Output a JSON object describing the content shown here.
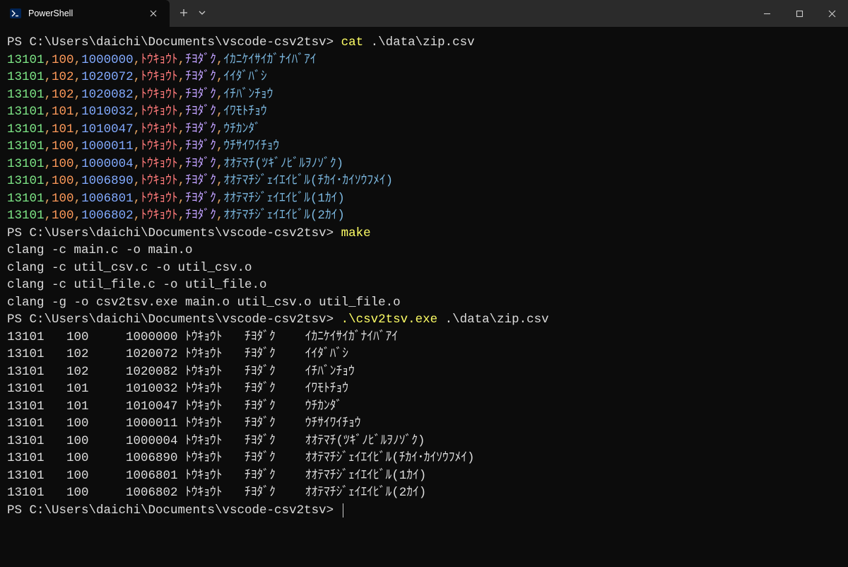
{
  "window": {
    "tab_title": "PowerShell"
  },
  "prompt": "PS C:\\Users\\daichi\\Documents\\vscode-csv2tsv>",
  "commands": {
    "cat": "cat",
    "cat_arg": ".\\data\\zip.csv",
    "make": "make",
    "run": ".\\csv2tsv.exe",
    "run_arg": ".\\data\\zip.csv"
  },
  "csv_rows": [
    {
      "a": "13101",
      "b": "100",
      "c": "1000000",
      "d": "ﾄｳｷｮｳﾄ",
      "e": "ﾁﾖﾀﾞｸ",
      "f": "ｲｶﾆｹｲｻｲｶﾞﾅｲﾊﾞｱｲ"
    },
    {
      "a": "13101",
      "b": "102",
      "c": "1020072",
      "d": "ﾄｳｷｮｳﾄ",
      "e": "ﾁﾖﾀﾞｸ",
      "f": "ｲｲﾀﾞﾊﾞｼ"
    },
    {
      "a": "13101",
      "b": "102",
      "c": "1020082",
      "d": "ﾄｳｷｮｳﾄ",
      "e": "ﾁﾖﾀﾞｸ",
      "f": "ｲﾁﾊﾞﾝﾁｮｳ"
    },
    {
      "a": "13101",
      "b": "101",
      "c": "1010032",
      "d": "ﾄｳｷｮｳﾄ",
      "e": "ﾁﾖﾀﾞｸ",
      "f": "ｲﾜﾓﾄﾁｮｳ"
    },
    {
      "a": "13101",
      "b": "101",
      "c": "1010047",
      "d": "ﾄｳｷｮｳﾄ",
      "e": "ﾁﾖﾀﾞｸ",
      "f": "ｳﾁｶﾝﾀﾞ"
    },
    {
      "a": "13101",
      "b": "100",
      "c": "1000011",
      "d": "ﾄｳｷｮｳﾄ",
      "e": "ﾁﾖﾀﾞｸ",
      "f": "ｳﾁｻｲﾜｲﾁｮｳ"
    },
    {
      "a": "13101",
      "b": "100",
      "c": "1000004",
      "d": "ﾄｳｷｮｳﾄ",
      "e": "ﾁﾖﾀﾞｸ",
      "f": "ｵｵﾃﾏﾁ(ﾂｷﾞﾉﾋﾞﾙｦﾉｿﾞｸ)"
    },
    {
      "a": "13101",
      "b": "100",
      "c": "1006890",
      "d": "ﾄｳｷｮｳﾄ",
      "e": "ﾁﾖﾀﾞｸ",
      "f": "ｵｵﾃﾏﾁｼﾞｪｲｴｲﾋﾞﾙ(ﾁｶｲ･ｶｲｿｳﾌﾒｲ)"
    },
    {
      "a": "13101",
      "b": "100",
      "c": "1006801",
      "d": "ﾄｳｷｮｳﾄ",
      "e": "ﾁﾖﾀﾞｸ",
      "f": "ｵｵﾃﾏﾁｼﾞｪｲｴｲﾋﾞﾙ(1ｶｲ)"
    },
    {
      "a": "13101",
      "b": "100",
      "c": "1006802",
      "d": "ﾄｳｷｮｳﾄ",
      "e": "ﾁﾖﾀﾞｸ",
      "f": "ｵｵﾃﾏﾁｼﾞｪｲｴｲﾋﾞﾙ(2ｶｲ)"
    }
  ],
  "make_output": [
    "clang -c main.c -o main.o",
    "clang -c util_csv.c -o util_csv.o",
    "clang -c util_file.c -o util_file.o",
    "clang -g -o csv2tsv.exe main.o util_csv.o util_file.o"
  ],
  "tsv_rows": [
    {
      "a": "13101",
      "b": "100",
      "c": "1000000",
      "d": "ﾄｳｷｮｳﾄ",
      "e": "ﾁﾖﾀﾞｸ",
      "f": "ｲｶﾆｹｲｻｲｶﾞﾅｲﾊﾞｱｲ"
    },
    {
      "a": "13101",
      "b": "102",
      "c": "1020072",
      "d": "ﾄｳｷｮｳﾄ",
      "e": "ﾁﾖﾀﾞｸ",
      "f": "ｲｲﾀﾞﾊﾞｼ"
    },
    {
      "a": "13101",
      "b": "102",
      "c": "1020082",
      "d": "ﾄｳｷｮｳﾄ",
      "e": "ﾁﾖﾀﾞｸ",
      "f": "ｲﾁﾊﾞﾝﾁｮｳ"
    },
    {
      "a": "13101",
      "b": "101",
      "c": "1010032",
      "d": "ﾄｳｷｮｳﾄ",
      "e": "ﾁﾖﾀﾞｸ",
      "f": "ｲﾜﾓﾄﾁｮｳ"
    },
    {
      "a": "13101",
      "b": "101",
      "c": "1010047",
      "d": "ﾄｳｷｮｳﾄ",
      "e": "ﾁﾖﾀﾞｸ",
      "f": "ｳﾁｶﾝﾀﾞ"
    },
    {
      "a": "13101",
      "b": "100",
      "c": "1000011",
      "d": "ﾄｳｷｮｳﾄ",
      "e": "ﾁﾖﾀﾞｸ",
      "f": "ｳﾁｻｲﾜｲﾁｮｳ"
    },
    {
      "a": "13101",
      "b": "100",
      "c": "1000004",
      "d": "ﾄｳｷｮｳﾄ",
      "e": "ﾁﾖﾀﾞｸ",
      "f": "ｵｵﾃﾏﾁ(ﾂｷﾞﾉﾋﾞﾙｦﾉｿﾞｸ)"
    },
    {
      "a": "13101",
      "b": "100",
      "c": "1006890",
      "d": "ﾄｳｷｮｳﾄ",
      "e": "ﾁﾖﾀﾞｸ",
      "f": "ｵｵﾃﾏﾁｼﾞｪｲｴｲﾋﾞﾙ(ﾁｶｲ･ｶｲｿｳﾌﾒｲ)"
    },
    {
      "a": "13101",
      "b": "100",
      "c": "1006801",
      "d": "ﾄｳｷｮｳﾄ",
      "e": "ﾁﾖﾀﾞｸ",
      "f": "ｵｵﾃﾏﾁｼﾞｪｲｴｲﾋﾞﾙ(1ｶｲ)"
    },
    {
      "a": "13101",
      "b": "100",
      "c": "1006802",
      "d": "ﾄｳｷｮｳﾄ",
      "e": "ﾁﾖﾀﾞｸ",
      "f": "ｵｵﾃﾏﾁｼﾞｪｲｴｲﾋﾞﾙ(2ｶｲ)"
    }
  ]
}
